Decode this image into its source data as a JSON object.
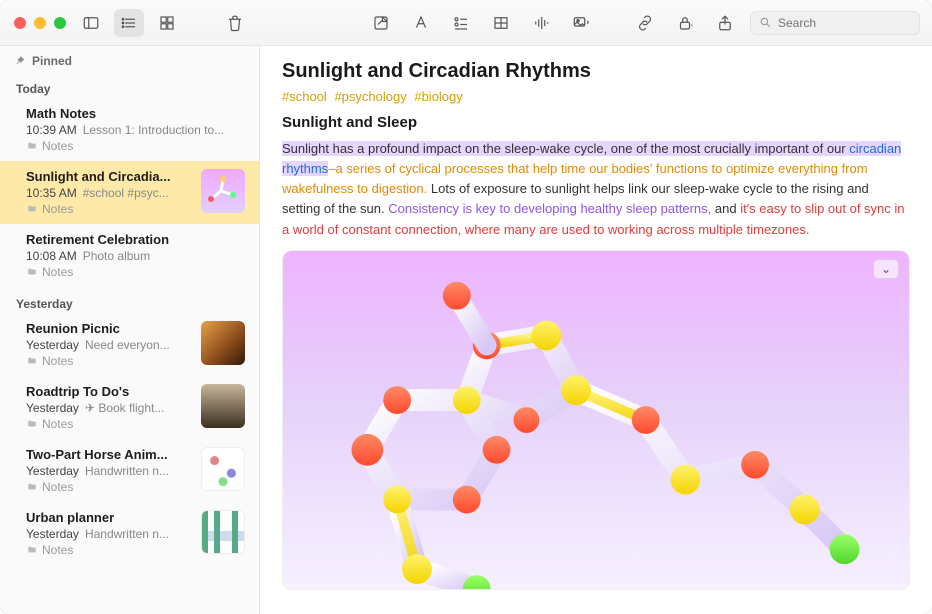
{
  "search": {
    "placeholder": "Search"
  },
  "sidebar": {
    "pinned_label": "Pinned",
    "today_label": "Today",
    "yesterday_label": "Yesterday",
    "folder_label": "Notes",
    "today": [
      {
        "title": "Math Notes",
        "time": "10:39 AM",
        "preview": "Lesson 1: Introduction to..."
      },
      {
        "title": "Sunlight and Circadia...",
        "time": "10:35 AM",
        "preview": "#school #psyc..."
      },
      {
        "title": "Retirement Celebration",
        "time": "10:08 AM",
        "preview": "Photo album"
      }
    ],
    "yesterday": [
      {
        "title": "Reunion Picnic",
        "time": "Yesterday",
        "preview": "Need everyon..."
      },
      {
        "title": "Roadtrip To Do's",
        "time": "Yesterday",
        "preview": "✈︎ Book flight..."
      },
      {
        "title": "Two-Part Horse Anim...",
        "time": "Yesterday",
        "preview": "Handwritten n..."
      },
      {
        "title": "Urban planner",
        "time": "Yesterday",
        "preview": "Handwritten n..."
      }
    ]
  },
  "note": {
    "title": "Sunlight and Circadian Rhythms",
    "tags": [
      "#school",
      "#psychology",
      "#biology"
    ],
    "subtitle": "Sunlight and Sleep",
    "spans": {
      "s1": "Sunlight has a profound impact on the sleep-wake cycle, one of the most crucially important of our ",
      "s2": "circadian rhythms",
      "s3": "–a series of cyclical processes that help time our bodies' functions to optimize everything from wakefulness to digestion.",
      "s4": " Lots of exposure to sunlight helps link our sleep-wake cycle to the rising and setting of the sun. ",
      "s5": "Consistency is key to developing healthy sleep patterns,",
      "s6": " and ",
      "s7": "it's easy to slip out of sync in a world of constant connection, where many are used to working across multiple timezones."
    },
    "image_menu_glyph": "⌄"
  }
}
